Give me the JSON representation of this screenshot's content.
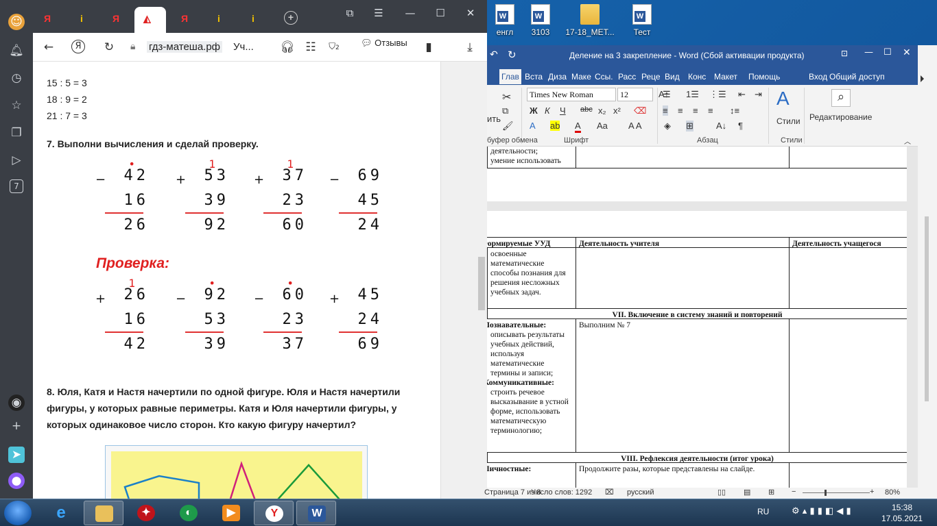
{
  "desktop": {
    "icons": [
      {
        "label": "енгл",
        "kind": "partial"
      },
      {
        "label": "3103",
        "kind": "word"
      },
      {
        "label": "17-18_МЕТ...",
        "kind": "folder"
      },
      {
        "label": "Тест",
        "kind": "word"
      }
    ]
  },
  "browser": {
    "tabs": [
      "Я",
      "i",
      "Я",
      "",
      "Я",
      "i",
      "i"
    ],
    "tab_colors": [
      "red",
      "yellow",
      "red",
      "active",
      "red",
      "yellow",
      "yellow"
    ],
    "address": {
      "domain": "гдз-матеша.рф",
      "title": "Уч..."
    },
    "reviews_label": "Отзывы",
    "badge_count": "2",
    "sidebar_badge": "7",
    "page": {
      "equations": [
        "15 : 5 = 3",
        "18 : 9 = 2",
        "21 : 7 = 3"
      ],
      "task7": "7. Выполни вычисления и сделай проверку.",
      "calcs": [
        {
          "sign": "−",
          "a": "42",
          "b": "16",
          "r": "26",
          "carry": "•"
        },
        {
          "sign": "+",
          "a": "53",
          "b": "39",
          "r": "92",
          "carry": "1"
        },
        {
          "sign": "+",
          "a": "37",
          "b": "23",
          "r": "60",
          "carry": "1"
        },
        {
          "sign": "−",
          "a": "69",
          "b": "45",
          "r": "24",
          "carry": ""
        }
      ],
      "check_title": "Проверка:",
      "checks": [
        {
          "sign": "+",
          "a": "26",
          "b": "16",
          "r": "42",
          "carry": "1"
        },
        {
          "sign": "−",
          "a": "92",
          "b": "53",
          "r": "39",
          "carry": "•"
        },
        {
          "sign": "−",
          "a": "60",
          "b": "23",
          "r": "37",
          "carry": "•"
        },
        {
          "sign": "+",
          "a": "45",
          "b": "24",
          "r": "69",
          "carry": ""
        }
      ],
      "task8": "8. Юля, Катя и Настя начертили по одной фигуре. Юля и Настя начертили фигуры, у которых равные периметры. Катя и Юля начертили фигуры, у которых одинаковое число сторон. Кто какую фигуру начертил?"
    }
  },
  "word": {
    "title": "Деление на 3 закрепление - Word (Сбой активации продукта)",
    "tabs": [
      "Глав",
      "Вста",
      "Диза",
      "Маке",
      "Ссы.",
      "Расс",
      "Реце",
      "Вид",
      "Конс",
      "Макет"
    ],
    "help": "Помощь",
    "login": "Вход",
    "share": "Общий доступ",
    "font_name": "Times New Roman",
    "font_size": "12",
    "paste_label": "ить",
    "group_labels": {
      "clipboard": "буфер обмена",
      "font": "Шрифт",
      "paragraph": "Абзац",
      "styles": "Стили"
    },
    "styles_label": "Стили",
    "editing_label": "Редактирование",
    "table": {
      "top_cells": [
        "деятельности;",
        "умение использовать"
      ],
      "header": [
        "Формируемые УУД",
        "Деятельность учителя",
        "Деятельность учащегося"
      ],
      "row1_uud": "освоенные математические способы познания для решения несложных учебных задач.",
      "section7": "VII. Включение в систему знаний и повторений",
      "row2_uud_title": "Познавательные:",
      "row2_uud": "описывать результаты учебных действий, используя математические термины и записи;",
      "row2_uud2_title": "Коммуникативные:",
      "row2_uud2": "строить речевое высказывание в устной форме, использовать математическую терминологию;",
      "row2_teacher": "Выполним № 7",
      "section8": "VIII. Рефлексия деятельности (итог урока)",
      "row3_uud_title": "Личностные:",
      "row3_teacher": "Продолжите разы, которые представлены на слайде."
    },
    "status": {
      "page": "Страница 7 из 8",
      "words": "Число слов: 1292",
      "lang": "русский",
      "zoom": "80%"
    }
  },
  "taskbar": {
    "lang": "RU",
    "time": "15:38",
    "date": "17.05.2021"
  }
}
